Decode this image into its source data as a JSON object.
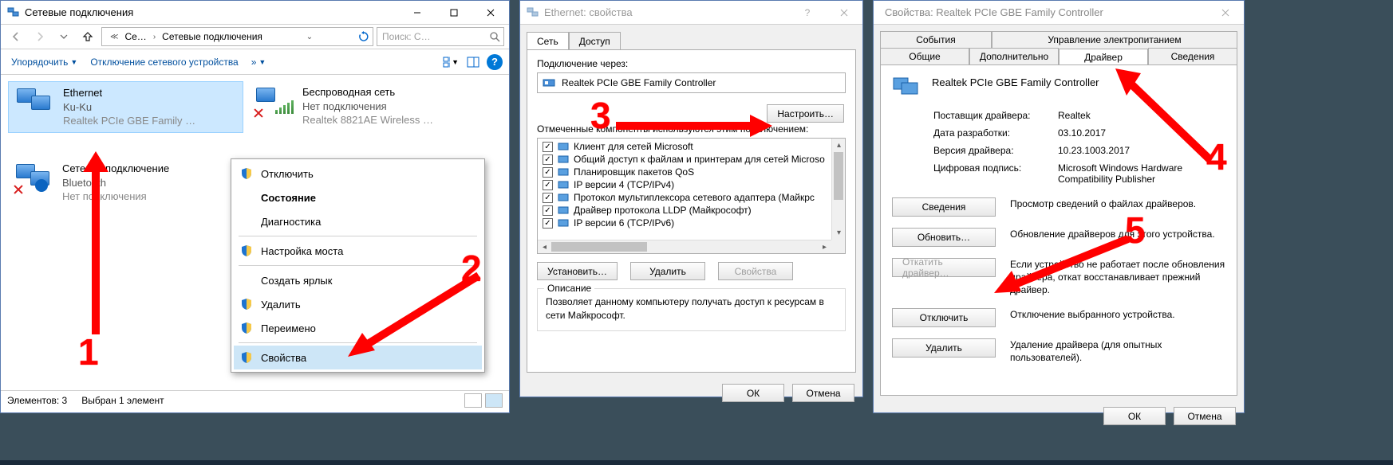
{
  "w1": {
    "title": "Сетевые подключения",
    "breadcrumb1": "Се…",
    "breadcrumb2": "Сетевые подключения",
    "search_placeholder": "Поиск: С…",
    "organize": "Упорядочить",
    "disable": "Отключение сетевого устройства",
    "more": "»",
    "conn_ethernet": {
      "name": "Ethernet",
      "status": "Ku-Ku",
      "device": "Realtek PCIe GBE Family …"
    },
    "conn_wifi": {
      "name": "Беспроводная сеть",
      "status": "Нет подключения",
      "device": "Realtek 8821AE Wireless …"
    },
    "conn_bt": {
      "name": "Сетевое подключение",
      "status": "Bluetooth",
      "device": "Нет подключения"
    },
    "ctx": {
      "disable": "Отключить",
      "status": "Состояние",
      "diag": "Диагностика",
      "bridge": "Настройка моста",
      "shortcut": "Создать ярлык",
      "delete": "Удалить",
      "rename": "Переимено",
      "props": "Свойства"
    },
    "status1": "Элементов: 3",
    "status2": "Выбран 1 элемент"
  },
  "w2": {
    "title": "Ethernet: свойства",
    "tab_net": "Сеть",
    "tab_access": "Доступ",
    "connect_via": "Подключение через:",
    "adapter": "Realtek PCIe GBE Family Controller",
    "configure": "Настроить…",
    "marked": "Отмеченные компоненты используются этим подключением:",
    "components": [
      "Клиент для сетей Microsoft",
      "Общий доступ к файлам и принтерам для сетей Microso",
      "Планировщик пакетов QoS",
      "IP версии 4 (TCP/IPv4)",
      "Протокол мультиплексора сетевого адаптера (Майкрс",
      "Драйвер протокола LLDP (Майкрософт)",
      "IP версии 6 (TCP/IPv6)"
    ],
    "install": "Установить…",
    "remove": "Удалить",
    "props": "Свойства",
    "desc_title": "Описание",
    "desc": "Позволяет данному компьютеру получать доступ к ресурсам в сети Майкрософт.",
    "ok": "ОК",
    "cancel": "Отмена"
  },
  "w3": {
    "title": "Свойства: Realtek PCIe GBE Family Controller",
    "tabs_row1": [
      "События",
      "Управление электропитанием"
    ],
    "tabs_row2": [
      "Общие",
      "Дополнительно",
      "Драйвер",
      "Сведения"
    ],
    "active_tab_index": 2,
    "device": "Realtek PCIe GBE Family Controller",
    "rows": [
      {
        "k": "Поставщик драйвера:",
        "v": "Realtek"
      },
      {
        "k": "Дата разработки:",
        "v": "03.10.2017"
      },
      {
        "k": "Версия драйвера:",
        "v": "10.23.1003.2017"
      },
      {
        "k": "Цифровая подпись:",
        "v": "Microsoft Windows Hardware Compatibility Publisher"
      }
    ],
    "btns": [
      {
        "label": "Сведения",
        "desc": "Просмотр сведений о файлах драйверов.",
        "disabled": false
      },
      {
        "label": "Обновить…",
        "desc": "Обновление драйверов для этого устройства.",
        "disabled": false
      },
      {
        "label": "Откатить драйвер…",
        "desc": "Если устройство не работает после обновления драйвера, откат восстанавливает прежний драйвер.",
        "disabled": true
      },
      {
        "label": "Отключить",
        "desc": "Отключение выбранного устройства.",
        "disabled": false
      },
      {
        "label": "Удалить",
        "desc": "Удаление драйвера (для опытных пользователей).",
        "disabled": false
      }
    ],
    "ok": "ОК",
    "cancel": "Отмена"
  },
  "annotations": {
    "1": "1",
    "2": "2",
    "3": "3",
    "4": "4",
    "5": "5"
  }
}
